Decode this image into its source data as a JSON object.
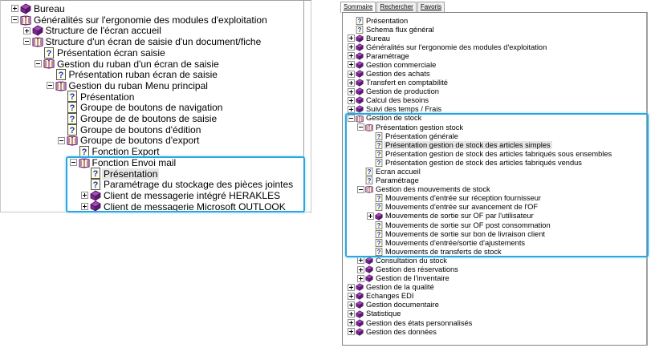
{
  "colors": {
    "highlight": "#29a8e0",
    "book": "#7b2a8a",
    "selected_bg": "#e6e6e6"
  },
  "left_tree": [
    {
      "level": 0,
      "toggle": "plus",
      "icon": "book-closed",
      "label": "Bureau"
    },
    {
      "level": 0,
      "toggle": "minus",
      "icon": "book-open",
      "label": "Généralités sur l'ergonomie des modules d'exploitation"
    },
    {
      "level": 1,
      "toggle": "plus",
      "icon": "book-closed",
      "label": "Structure de l'écran accueil"
    },
    {
      "level": 1,
      "toggle": "minus",
      "icon": "book-open",
      "label": "Structure d'un écran de saisie d'un document/fiche"
    },
    {
      "level": 2,
      "toggle": "none",
      "icon": "page",
      "label": "Présentation écran saisie"
    },
    {
      "level": 2,
      "toggle": "minus",
      "icon": "book-open",
      "label": "Gestion du ruban d'un écran de saisie"
    },
    {
      "level": 3,
      "toggle": "none",
      "icon": "page",
      "label": "Présentation ruban écran de saisie"
    },
    {
      "level": 3,
      "toggle": "minus",
      "icon": "book-open",
      "label": "Gestion du ruban Menu principal"
    },
    {
      "level": 4,
      "toggle": "none",
      "icon": "page",
      "label": "Présentation"
    },
    {
      "level": 4,
      "toggle": "none",
      "icon": "page",
      "label": "Groupe de boutons de navigation"
    },
    {
      "level": 4,
      "toggle": "none",
      "icon": "page",
      "label": "Groupe de de boutons de saisie"
    },
    {
      "level": 4,
      "toggle": "none",
      "icon": "page",
      "label": "Groupe de boutons d'édition"
    },
    {
      "level": 4,
      "toggle": "minus",
      "icon": "book-open",
      "label": "Groupe de boutons d'export"
    },
    {
      "level": 5,
      "toggle": "none",
      "icon": "page",
      "label": "Fonction Export"
    },
    {
      "level": 5,
      "toggle": "minus",
      "icon": "book-open",
      "label": "Fonction Envoi mail"
    },
    {
      "level": 6,
      "toggle": "none",
      "icon": "page",
      "label": "Présentation",
      "selected": true
    },
    {
      "level": 6,
      "toggle": "none",
      "icon": "page",
      "label": "Paramétrage du stockage des pièces jointes"
    },
    {
      "level": 6,
      "toggle": "plus",
      "icon": "book-closed",
      "label": "Client de messagerie intégré HERAKLES"
    },
    {
      "level": 6,
      "toggle": "plus",
      "icon": "book-closed",
      "label": "Client de messagerie Microsoft OUTLOOK"
    }
  ],
  "right_tabs": [
    {
      "label": "Sommaire",
      "active": true
    },
    {
      "label": "Rechercher"
    },
    {
      "label": "Favoris"
    }
  ],
  "right_tree": [
    {
      "level": 0,
      "toggle": "none",
      "icon": "page",
      "label": "Présentation"
    },
    {
      "level": 0,
      "toggle": "none",
      "icon": "page",
      "label": "Schema flux général"
    },
    {
      "level": 0,
      "toggle": "plus",
      "icon": "book-closed",
      "label": "Bureau"
    },
    {
      "level": 0,
      "toggle": "plus",
      "icon": "book-closed",
      "label": "Généralités sur l'ergonomie des modules d'exploitation"
    },
    {
      "level": 0,
      "toggle": "plus",
      "icon": "book-closed",
      "label": "Paramétrage"
    },
    {
      "level": 0,
      "toggle": "plus",
      "icon": "book-closed",
      "label": "Gestion commerciale"
    },
    {
      "level": 0,
      "toggle": "plus",
      "icon": "book-closed",
      "label": "Gestion des achats"
    },
    {
      "level": 0,
      "toggle": "plus",
      "icon": "book-closed",
      "label": "Transfert  en comptabilité"
    },
    {
      "level": 0,
      "toggle": "plus",
      "icon": "book-closed",
      "label": "Gestion de production"
    },
    {
      "level": 0,
      "toggle": "plus",
      "icon": "book-closed",
      "label": "Calcul des besoins"
    },
    {
      "level": 0,
      "toggle": "plus",
      "icon": "book-closed",
      "label": "Suivi des temps / Frais"
    },
    {
      "level": 0,
      "toggle": "minus",
      "icon": "book-open",
      "label": "Gestion de stock"
    },
    {
      "level": 1,
      "toggle": "minus",
      "icon": "book-open",
      "label": "Présentation gestion stock"
    },
    {
      "level": 2,
      "toggle": "none",
      "icon": "page",
      "label": "Présentation générale"
    },
    {
      "level": 2,
      "toggle": "none",
      "icon": "page",
      "label": "Présentation gestion de stock des articles simples",
      "selected": true
    },
    {
      "level": 2,
      "toggle": "none",
      "icon": "page",
      "label": "Présentation gestion de stock des articles fabriqués sous ensembles"
    },
    {
      "level": 2,
      "toggle": "none",
      "icon": "page",
      "label": "Présentation gestion de stock des articles fabriqués vendus"
    },
    {
      "level": 1,
      "toggle": "none",
      "icon": "page",
      "label": "Ecran accueil"
    },
    {
      "level": 1,
      "toggle": "none",
      "icon": "page",
      "label": "Paramétrage"
    },
    {
      "level": 1,
      "toggle": "minus",
      "icon": "book-open",
      "label": "Gestion des mouvements de stock"
    },
    {
      "level": 2,
      "toggle": "none",
      "icon": "page",
      "label": "Mouvements d'entrée sur réception fournisseur"
    },
    {
      "level": 2,
      "toggle": "none",
      "icon": "page",
      "label": "Mouvements d'entrée sur avancement de l'OF"
    },
    {
      "level": 2,
      "toggle": "plus",
      "icon": "book-closed",
      "label": "Mouvements de sortie sur OF par l'utilisateur"
    },
    {
      "level": 2,
      "toggle": "none",
      "icon": "page",
      "label": "Mouvements de sortie sur OF post consommation"
    },
    {
      "level": 2,
      "toggle": "none",
      "icon": "page",
      "label": "Mouvements de sortie sur bon de livraison client"
    },
    {
      "level": 2,
      "toggle": "none",
      "icon": "page",
      "label": "Mouvements d'entrée/sortie d'ajustements"
    },
    {
      "level": 2,
      "toggle": "none",
      "icon": "page",
      "label": "Mouvements de transferts de stock"
    },
    {
      "level": 1,
      "toggle": "plus",
      "icon": "book-closed",
      "label": "Consultation du stock"
    },
    {
      "level": 1,
      "toggle": "plus",
      "icon": "book-closed",
      "label": "Gestion des réservations"
    },
    {
      "level": 1,
      "toggle": "plus",
      "icon": "book-closed",
      "label": "Gestion de l'inventaire"
    },
    {
      "level": 0,
      "toggle": "plus",
      "icon": "book-closed",
      "label": "Gestion de la qualité"
    },
    {
      "level": 0,
      "toggle": "plus",
      "icon": "book-closed",
      "label": "Echanges EDI"
    },
    {
      "level": 0,
      "toggle": "plus",
      "icon": "book-closed",
      "label": "Gestion documentaire"
    },
    {
      "level": 0,
      "toggle": "plus",
      "icon": "book-closed",
      "label": "Statistique"
    },
    {
      "level": 0,
      "toggle": "plus",
      "icon": "book-closed",
      "label": "Gestion des états personnalisés"
    },
    {
      "level": 0,
      "toggle": "plus",
      "icon": "book-closed",
      "label": "Gestion des données"
    }
  ]
}
